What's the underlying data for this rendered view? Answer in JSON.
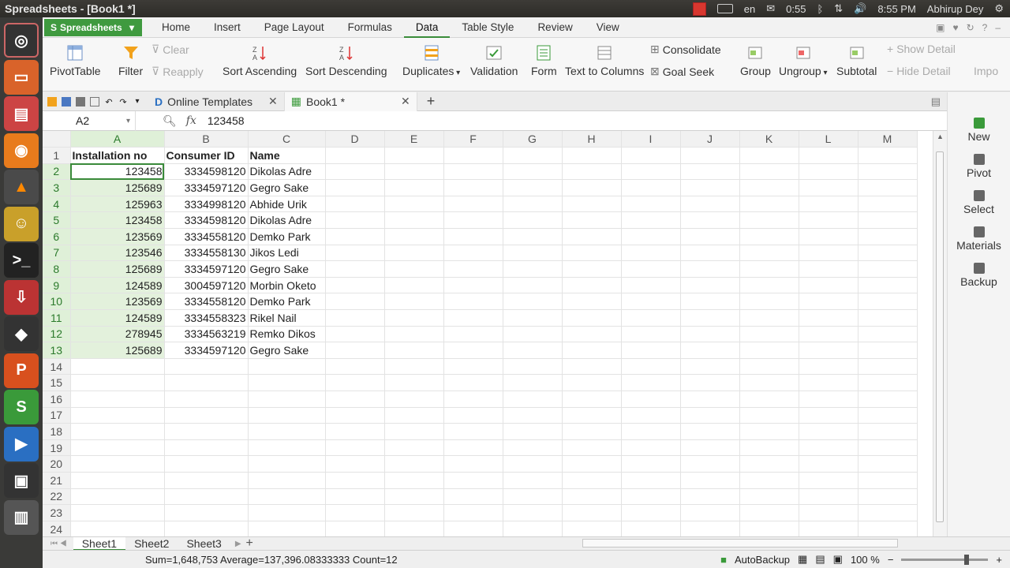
{
  "topbar": {
    "title": "Spreadsheets - [Book1 *]",
    "keyboard": "en",
    "battery": "0:55",
    "clock": "8:55 PM",
    "user": "Abhirup Dey"
  },
  "menu": {
    "app_button": "Spreadsheets",
    "tabs": [
      "Home",
      "Insert",
      "Page Layout",
      "Formulas",
      "Data",
      "Table Style",
      "Review",
      "View"
    ],
    "active_tab": "Data"
  },
  "ribbon": {
    "pivot": "PivotTable",
    "filter": "Filter",
    "clear": "Clear",
    "reapply": "Reapply",
    "sort_asc": "Sort Ascending",
    "sort_desc": "Sort Descending",
    "duplicates": "Duplicates",
    "validation": "Validation",
    "form": "Form",
    "text_to_columns": "Text to Columns",
    "consolidate": "Consolidate",
    "goal_seek": "Goal Seek",
    "group": "Group",
    "ungroup": "Ungroup",
    "subtotal": "Subtotal",
    "show_detail": "Show Detail",
    "hide_detail": "Hide Detail",
    "import": "Impo"
  },
  "doctabs": {
    "online": "Online Templates",
    "book": "Book1 *"
  },
  "formula": {
    "name_box": "A2",
    "fx": "fx",
    "value": "123458"
  },
  "columns": [
    "A",
    "B",
    "C",
    "D",
    "E",
    "F",
    "G",
    "H",
    "I",
    "J",
    "K",
    "L",
    "M"
  ],
  "rows": [
    "1",
    "2",
    "3",
    "4",
    "5",
    "6",
    "7",
    "8",
    "9",
    "10",
    "11",
    "12",
    "13",
    "14",
    "15",
    "16",
    "17",
    "18",
    "19",
    "20",
    "21",
    "22",
    "23",
    "24"
  ],
  "data": {
    "headers": [
      "Installation no",
      "Consumer ID",
      "Name"
    ],
    "records": [
      [
        "123458",
        "3334598120",
        "Dikolas Adre"
      ],
      [
        "125689",
        "3334597120",
        "Gegro Sake"
      ],
      [
        "125963",
        "3334998120",
        "Abhide Urik"
      ],
      [
        "123458",
        "3334598120",
        "Dikolas Adre"
      ],
      [
        "123569",
        "3334558120",
        "Demko Park"
      ],
      [
        "123546",
        "3334558130",
        "Jikos Ledi"
      ],
      [
        "125689",
        "3334597120",
        "Gegro Sake"
      ],
      [
        "124589",
        "3004597120",
        "Morbin Oketo"
      ],
      [
        "123569",
        "3334558120",
        "Demko Park"
      ],
      [
        "124589",
        "3334558323",
        "Rikel Nail"
      ],
      [
        "278945",
        "3334563219",
        "Remko Dikos"
      ],
      [
        "125689",
        "3334597120",
        "Gegro Sake"
      ]
    ]
  },
  "side": [
    "New",
    "Pivot",
    "Select",
    "Materials",
    "Backup"
  ],
  "sheets": [
    "Sheet1",
    "Sheet2",
    "Sheet3"
  ],
  "status": {
    "summary": "Sum=1,648,753  Average=137,396.08333333  Count=12",
    "autobackup": "AutoBackup",
    "zoom": "100 %"
  }
}
